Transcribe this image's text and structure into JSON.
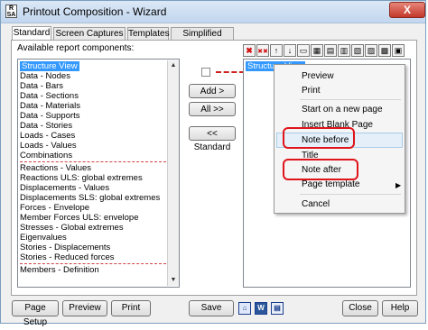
{
  "window": {
    "title": "Printout Composition - Wizard",
    "icon_text": "R\nSA",
    "close_symbol": "X"
  },
  "tabs": [
    "Standard",
    "Screen Captures",
    "Templates",
    "Simplified printout"
  ],
  "available": {
    "label": "Available report components:",
    "items": [
      "Structure View",
      "Data - Nodes",
      "Data - Bars",
      "Data - Sections",
      "Data - Materials",
      "Data - Supports",
      "Data - Stories",
      "Loads - Cases",
      "Loads - Values",
      "Combinations",
      "Reactions - Values",
      "Reactions ULS: global extremes",
      "Displacements - Values",
      "Displacements SLS: global extremes",
      "Forces - Envelope",
      "Member Forces ULS: envelope",
      "Stresses - Global extremes",
      "Eigenvalues",
      "Stories - Displacements",
      "Stories - Reduced forces",
      "Members - Definition"
    ],
    "selected_index": 0
  },
  "middle_buttons": {
    "add": "Add >",
    "all": "All >>",
    "standard": "<< Standard"
  },
  "right_list": {
    "items": [
      "Structure View"
    ]
  },
  "context_menu": {
    "items": [
      "Preview",
      "Print",
      "Start on a new page",
      "Insert Blank Page",
      "Note before",
      "Title",
      "Note after",
      "Page template",
      "Cancel"
    ],
    "submenu_arrow": "▶"
  },
  "footer": {
    "page_setup": "Page Setup",
    "preview": "Preview",
    "print": "Print",
    "save": "Save",
    "close": "Close",
    "help": "Help"
  }
}
